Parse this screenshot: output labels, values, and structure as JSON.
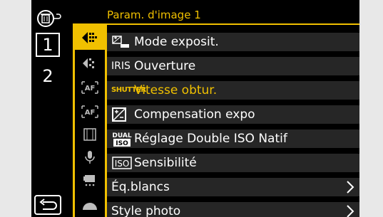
{
  "menu": {
    "title": "Param. d'image 1",
    "pages": [
      "1",
      "2"
    ],
    "items": [
      {
        "icon": "exposure-mode-icon",
        "label": "Mode exposit.",
        "has_submenu": false
      },
      {
        "icon": "IRIS",
        "label": "Ouverture",
        "has_submenu": false
      },
      {
        "icon": "SHUTTER",
        "label": "Vitesse obtur.",
        "has_submenu": false,
        "selected": true
      },
      {
        "icon": "exposure-comp-icon",
        "label": "Compensation expo",
        "has_submenu": false
      },
      {
        "icon": "DUAL ISO",
        "label": "Réglage Double ISO Natif",
        "has_submenu": false
      },
      {
        "icon": "ISO",
        "label": "Sensibilité",
        "has_submenu": false
      },
      {
        "icon": "",
        "label": "Éq.blancs",
        "has_submenu": true
      },
      {
        "icon": "",
        "label": "Style photo",
        "has_submenu": true
      }
    ]
  },
  "tabs": [
    "image-settings-tab-icon",
    "image-format-tab-icon",
    "af-tab-icon",
    "af-settings-tab-icon",
    "video-tab-icon",
    "mic-tab-icon",
    "camera-tab-icon",
    "custom-tab-icon"
  ],
  "colors": {
    "accent": "#f0c000",
    "row_bg": "#262626",
    "background": "#000000"
  }
}
